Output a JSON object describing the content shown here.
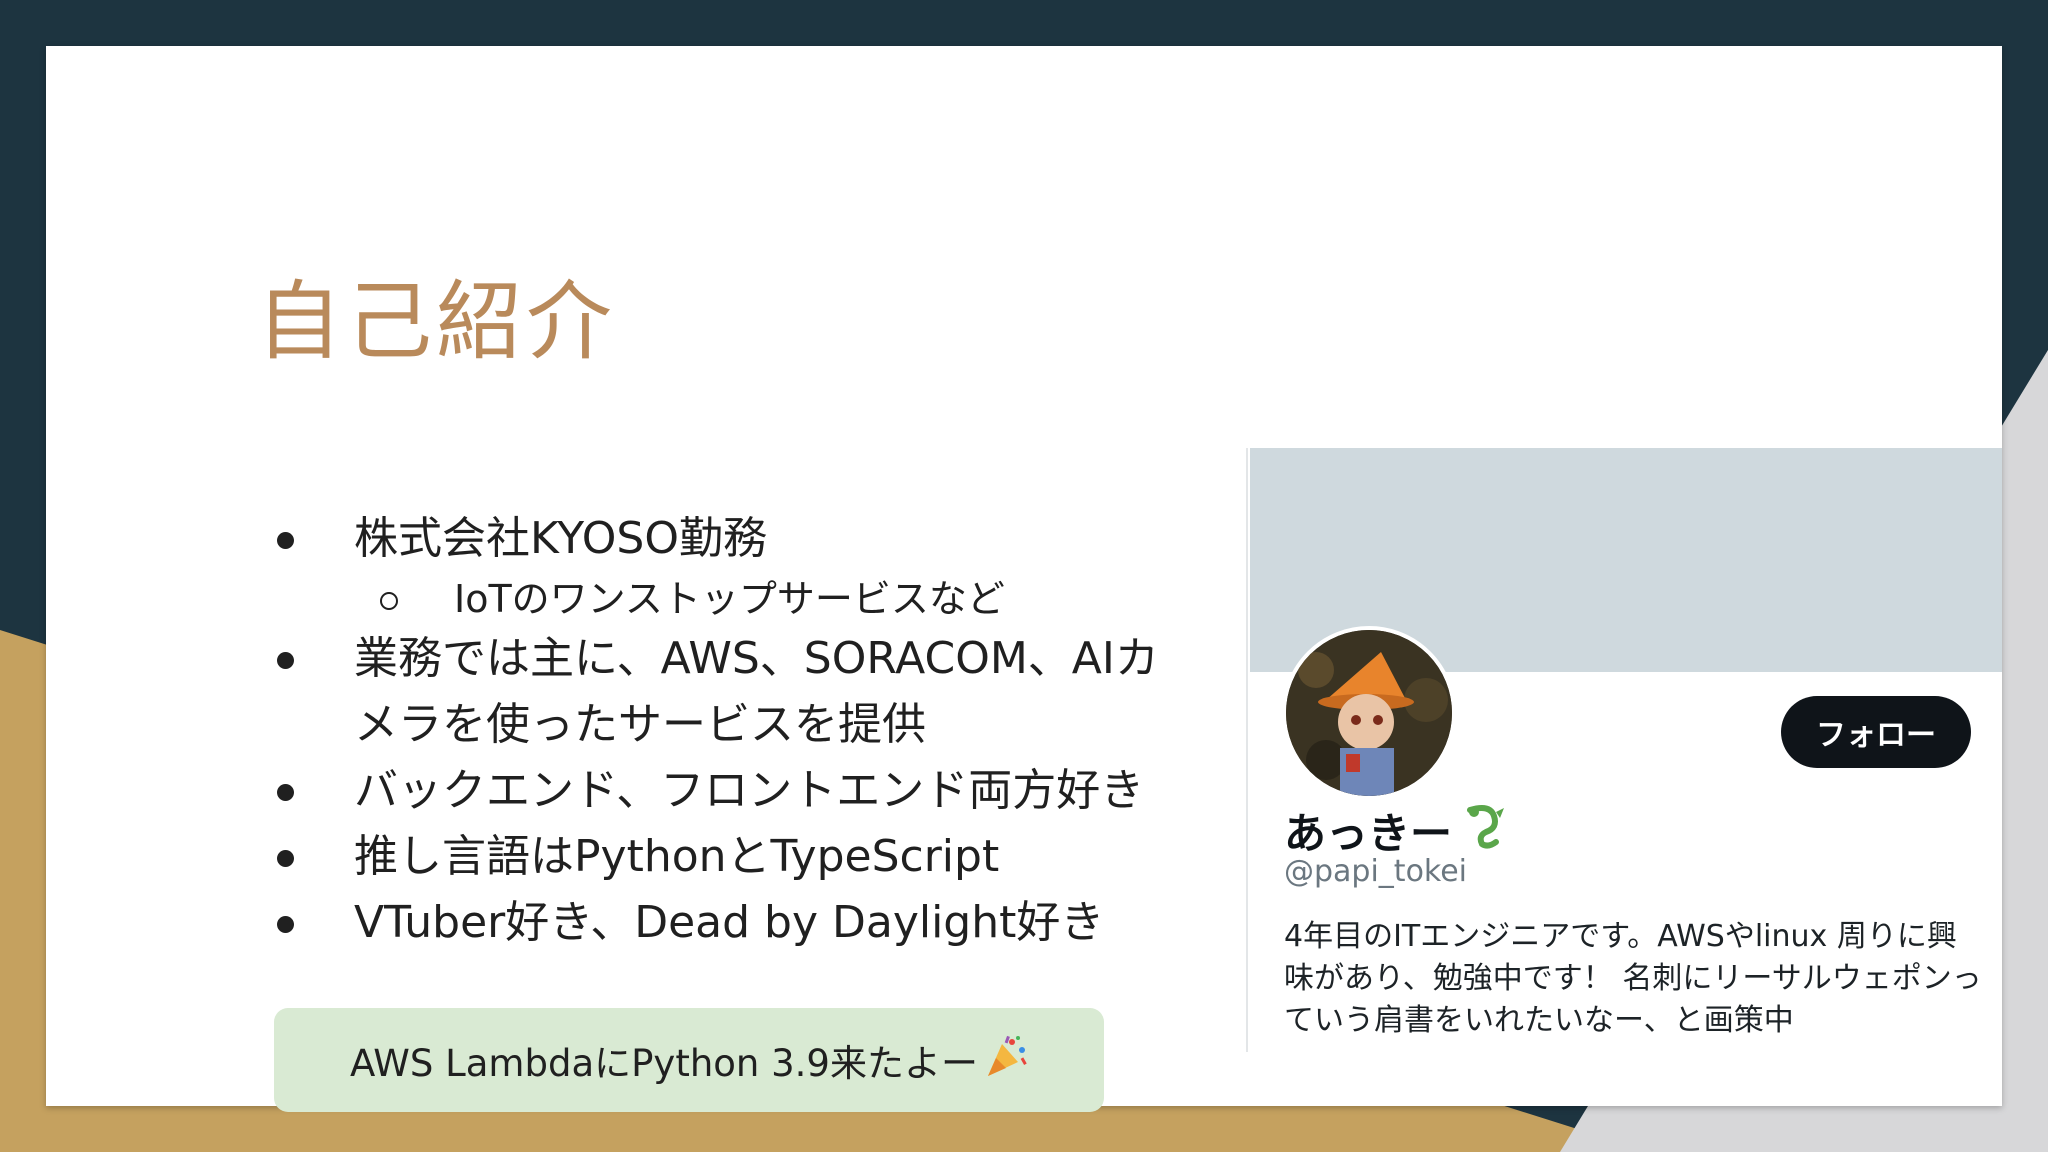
{
  "slide": {
    "title": "自己紹介",
    "bullets": [
      {
        "text": "株式会社KYOSO勤務",
        "sub": [
          "IoTのワンストップサービスなど"
        ]
      },
      {
        "text": "業務では主に、AWS、SORACOM、AIカメラを使ったサービスを提供",
        "sub": []
      },
      {
        "text": "バックエンド、フロントエンド両方好き",
        "sub": []
      },
      {
        "text": "推し言語はPythonとTypeScript",
        "sub": []
      },
      {
        "text": "VTuber好き、Dead by Daylight好き",
        "sub": []
      }
    ],
    "note": "AWS LambdaにPython 3.9来たよー",
    "note_icon": "party-popper-icon"
  },
  "profile": {
    "display_name": "あっきー",
    "name_icon": "green-dragon-icon",
    "handle": "@papi_tokei",
    "follow_label": "フォロー",
    "bio": "4年目のITエンジニアです。AWSやlinux 周りに興味があり、勉強中です！ 名刺にリーサルウェポンっていう肩書をいれたいなー、と画策中",
    "banner_color": "#cfd9de",
    "avatar": "avatar-photo"
  },
  "colors": {
    "title": "#b98a5b",
    "background_dark": "#1d3440",
    "background_gold": "#c5a15f",
    "note_bg": "#d9ead3"
  }
}
